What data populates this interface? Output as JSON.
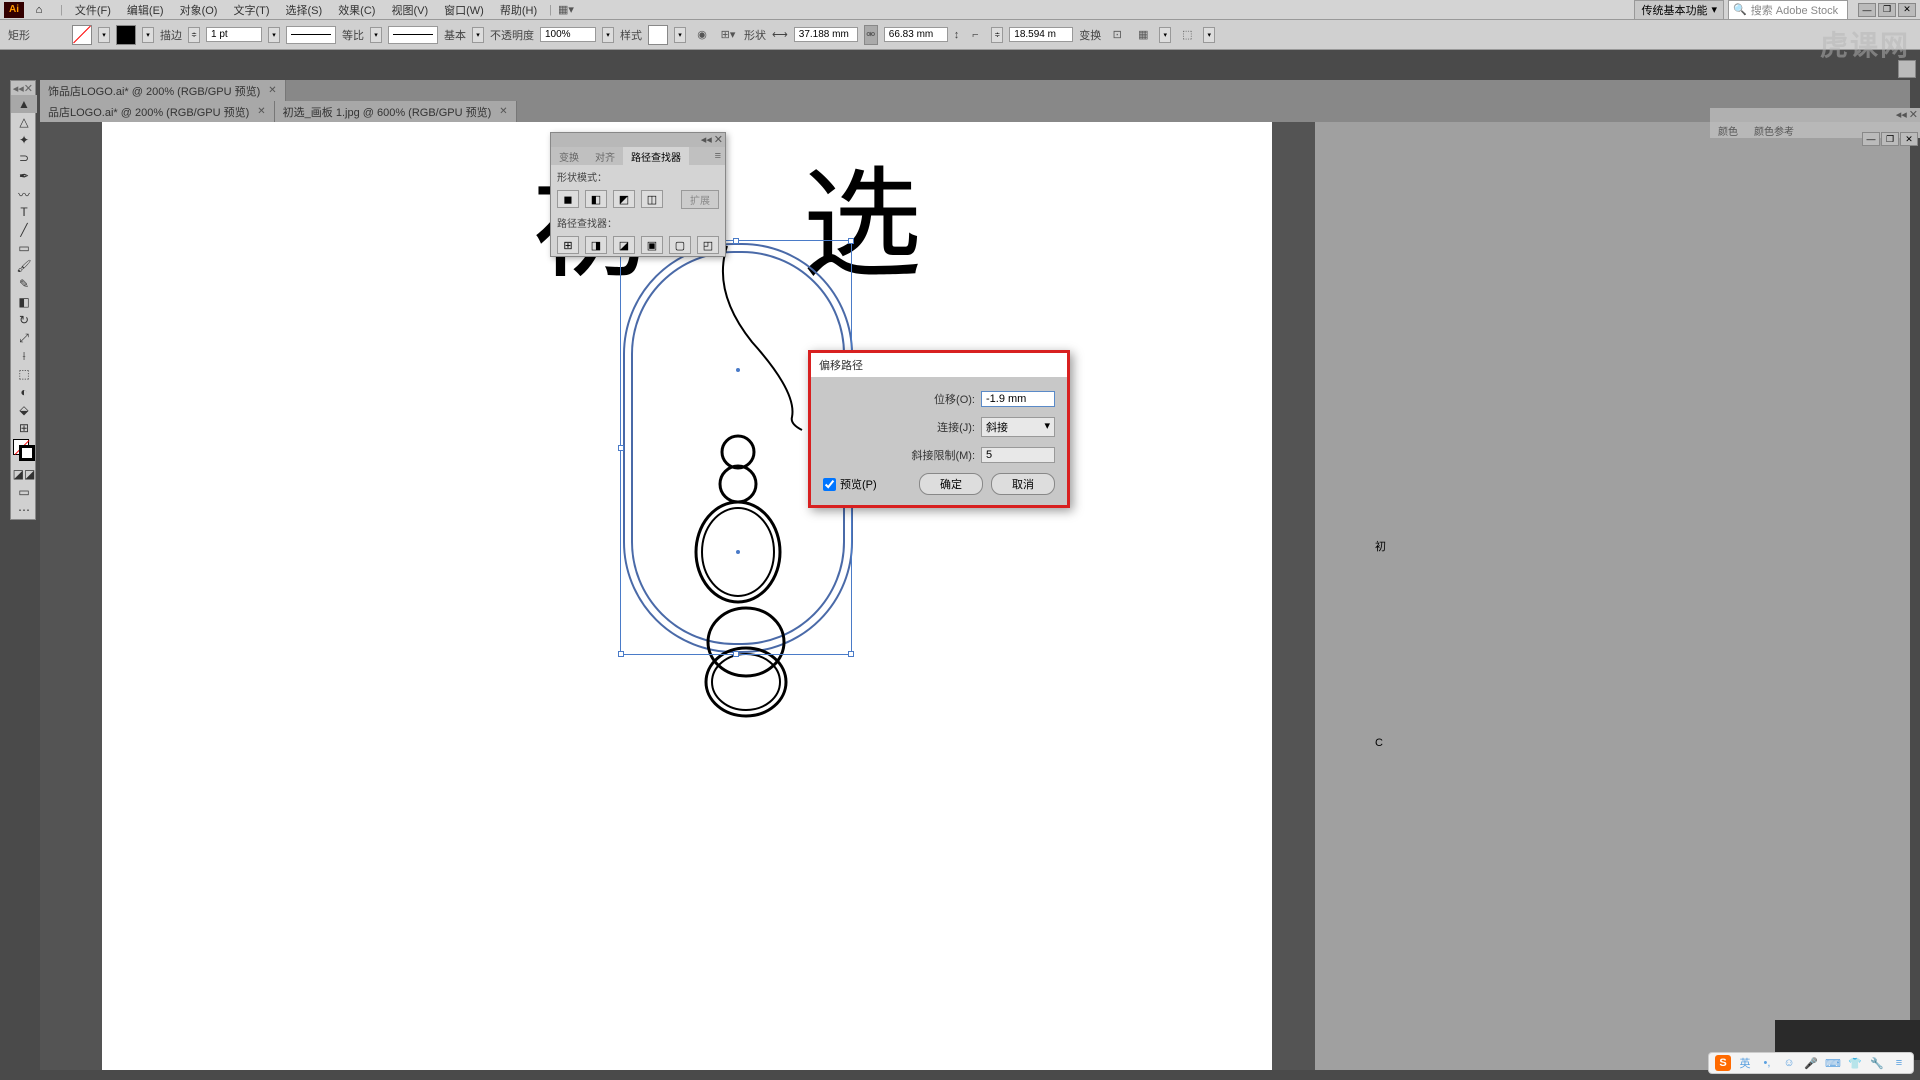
{
  "menu": {
    "items": [
      "文件(F)",
      "编辑(E)",
      "对象(O)",
      "文字(T)",
      "选择(S)",
      "效果(C)",
      "视图(V)",
      "窗口(W)",
      "帮助(H)"
    ],
    "workspace": "传统基本功能",
    "search_placeholder": "搜索 Adobe Stock"
  },
  "ctrl": {
    "shape": "矩形",
    "stroke_label": "描边",
    "stroke_val": "1 pt",
    "uniform": "等比",
    "basic": "基本",
    "opacity_label": "不透明度",
    "opacity_val": "100%",
    "style": "样式",
    "trans_label": "形状",
    "w_val": "37.188 mm",
    "h_val": "66.83 mm",
    "r_val": "18.594 m",
    "transform": "变换"
  },
  "tabs": {
    "t1": "饰品店LOGO.ai* @ 200% (RGB/GPU 预览)",
    "t2": "品店LOGO.ai* @ 200% (RGB/GPU 预览)",
    "t3": "初选_画板 1.jpg @ 600% (RGB/GPU 预览)"
  },
  "art": {
    "chu": "初",
    "xuan": "选",
    "side1": "初",
    "side2": "C"
  },
  "pathfinder": {
    "tab1": "变换",
    "tab2": "对齐",
    "tab3": "路径查找器",
    "sect1": "形状模式：",
    "sect2": "路径查找器：",
    "expand": "扩展"
  },
  "dialog": {
    "title": "偏移路径",
    "offset_lbl": "位移(O):",
    "offset_val": "-1.9 mm",
    "join_lbl": "连接(J):",
    "join_val": "斜接",
    "miter_lbl": "斜接限制(M):",
    "miter_val": "5",
    "preview": "预览(P)",
    "ok": "确定",
    "cancel": "取消"
  },
  "panel": {
    "tab1": "颜色",
    "tab2": "颜色参考"
  },
  "watermark": "虎课网",
  "ime": {
    "lang": "英"
  }
}
